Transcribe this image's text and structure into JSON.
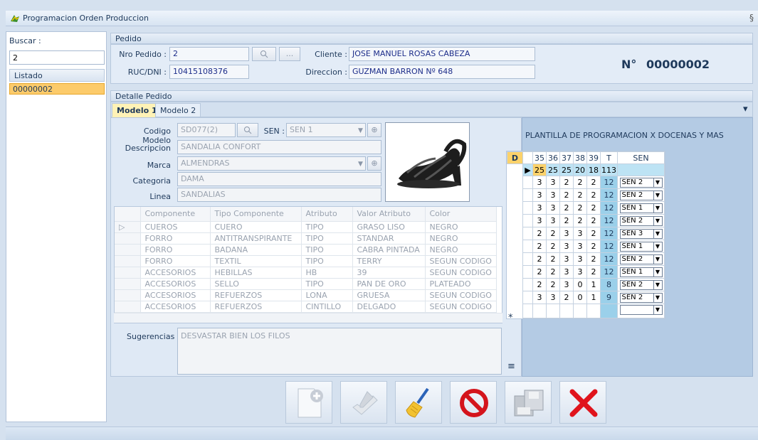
{
  "window": {
    "title": "Programacion Orden Produccion",
    "close_glyph": "§"
  },
  "left": {
    "search_label": "Buscar :",
    "search_value": "2",
    "listado_header": "Listado",
    "listado_items": [
      "00000002"
    ]
  },
  "pedido": {
    "header": "Pedido",
    "nro_label": "Nro Pedido :",
    "nro_value": "2",
    "ellipsis": "...",
    "ruc_label": "RUC/DNI :",
    "ruc_value": "10415108376",
    "cliente_label": "Cliente :",
    "cliente_value": "JOSE MANUEL ROSAS CABEZA",
    "direccion_label": "Direccion :",
    "direccion_value": "GUZMAN BARRON Nº 648",
    "orden_label": "N°",
    "orden_number": "00000002"
  },
  "detalle": {
    "header": "Detalle Pedido",
    "tabs": [
      "Modelo 1",
      "Modelo 2"
    ],
    "codigo_label": "Codigo Modelo",
    "codigo_value": "SD077(2)",
    "sen_label": "SEN :",
    "sen_value": "SEN 1",
    "descripcion_label": "Descripcion",
    "descripcion_value": "SANDALIA CONFORT",
    "marca_label": "Marca",
    "marca_value": "ALMENDRAS",
    "categoria_label": "Categoria",
    "categoria_value": "DAMA",
    "linea_label": "Linea",
    "linea_value": "SANDALIAS",
    "columns": [
      "Componente",
      "Tipo Componente",
      "Atributo",
      "Valor Atributo",
      "Color"
    ],
    "rows": [
      [
        "CUEROS",
        "CUERO",
        "TIPO",
        "GRASO LISO",
        "NEGRO"
      ],
      [
        "FORRO",
        "ANTITRANSPIRANTE",
        "TIPO",
        "STANDAR",
        "NEGRO"
      ],
      [
        "FORRO",
        "BADANA",
        "TIPO",
        "CABRA PINTADA",
        "NEGRO"
      ],
      [
        "FORRO",
        "TEXTIL",
        "TIPO",
        "TERRY",
        "SEGUN CODIGO"
      ],
      [
        "ACCESORIOS",
        "HEBILLAS",
        "HB",
        "39",
        "SEGUN CODIGO"
      ],
      [
        "ACCESORIOS",
        "SELLO",
        "TIPO",
        "PAN DE ORO",
        "PLATEADO"
      ],
      [
        "ACCESORIOS",
        "REFUERZOS",
        "LONA",
        "GRUESA",
        "SEGUN CODIGO"
      ],
      [
        "ACCESORIOS",
        "REFUERZOS",
        "CINTILLO",
        "DELGADO",
        "SEGUN CODIGO"
      ]
    ],
    "sugerencias_label": "Sugerencias :",
    "sugerencias_value": "DESVASTAR BIEN LOS FILOS"
  },
  "plantilla": {
    "title": "PLANTILLA DE PROGRAMACION X DOCENAS Y MAS",
    "d_label": "D",
    "headers": [
      "35",
      "36",
      "37",
      "38",
      "39",
      "T",
      "SEN"
    ],
    "totals": [
      "25",
      "25",
      "25",
      "20",
      "18",
      "113"
    ],
    "rows": [
      {
        "values": [
          "3",
          "3",
          "2",
          "2",
          "2",
          "12"
        ],
        "sen": "SEN 2"
      },
      {
        "values": [
          "3",
          "3",
          "2",
          "2",
          "2",
          "12"
        ],
        "sen": "SEN 2"
      },
      {
        "values": [
          "3",
          "3",
          "2",
          "2",
          "2",
          "12"
        ],
        "sen": "SEN 1"
      },
      {
        "values": [
          "3",
          "3",
          "2",
          "2",
          "2",
          "12"
        ],
        "sen": "SEN 2"
      },
      {
        "values": [
          "2",
          "2",
          "3",
          "3",
          "2",
          "12"
        ],
        "sen": "SEN 3"
      },
      {
        "values": [
          "2",
          "2",
          "3",
          "3",
          "2",
          "12"
        ],
        "sen": "SEN 1"
      },
      {
        "values": [
          "2",
          "2",
          "3",
          "3",
          "2",
          "12"
        ],
        "sen": "SEN 2"
      },
      {
        "values": [
          "2",
          "2",
          "3",
          "3",
          "2",
          "12"
        ],
        "sen": "SEN 1"
      },
      {
        "values": [
          "2",
          "2",
          "3",
          "0",
          "1",
          "8"
        ],
        "sen": "SEN 2"
      },
      {
        "values": [
          "3",
          "3",
          "2",
          "0",
          "1",
          "9"
        ],
        "sen": "SEN 2"
      }
    ],
    "new_row_marker": "*"
  },
  "actions": [
    {
      "name": "new-document-button",
      "icon": "new-document-icon"
    },
    {
      "name": "edit-button",
      "icon": "edit-icon"
    },
    {
      "name": "clear-button",
      "icon": "broom-icon"
    },
    {
      "name": "cancel-button",
      "icon": "prohibited-icon"
    },
    {
      "name": "save-button",
      "icon": "save-icon"
    },
    {
      "name": "close-button",
      "icon": "red-x-icon"
    }
  ]
}
